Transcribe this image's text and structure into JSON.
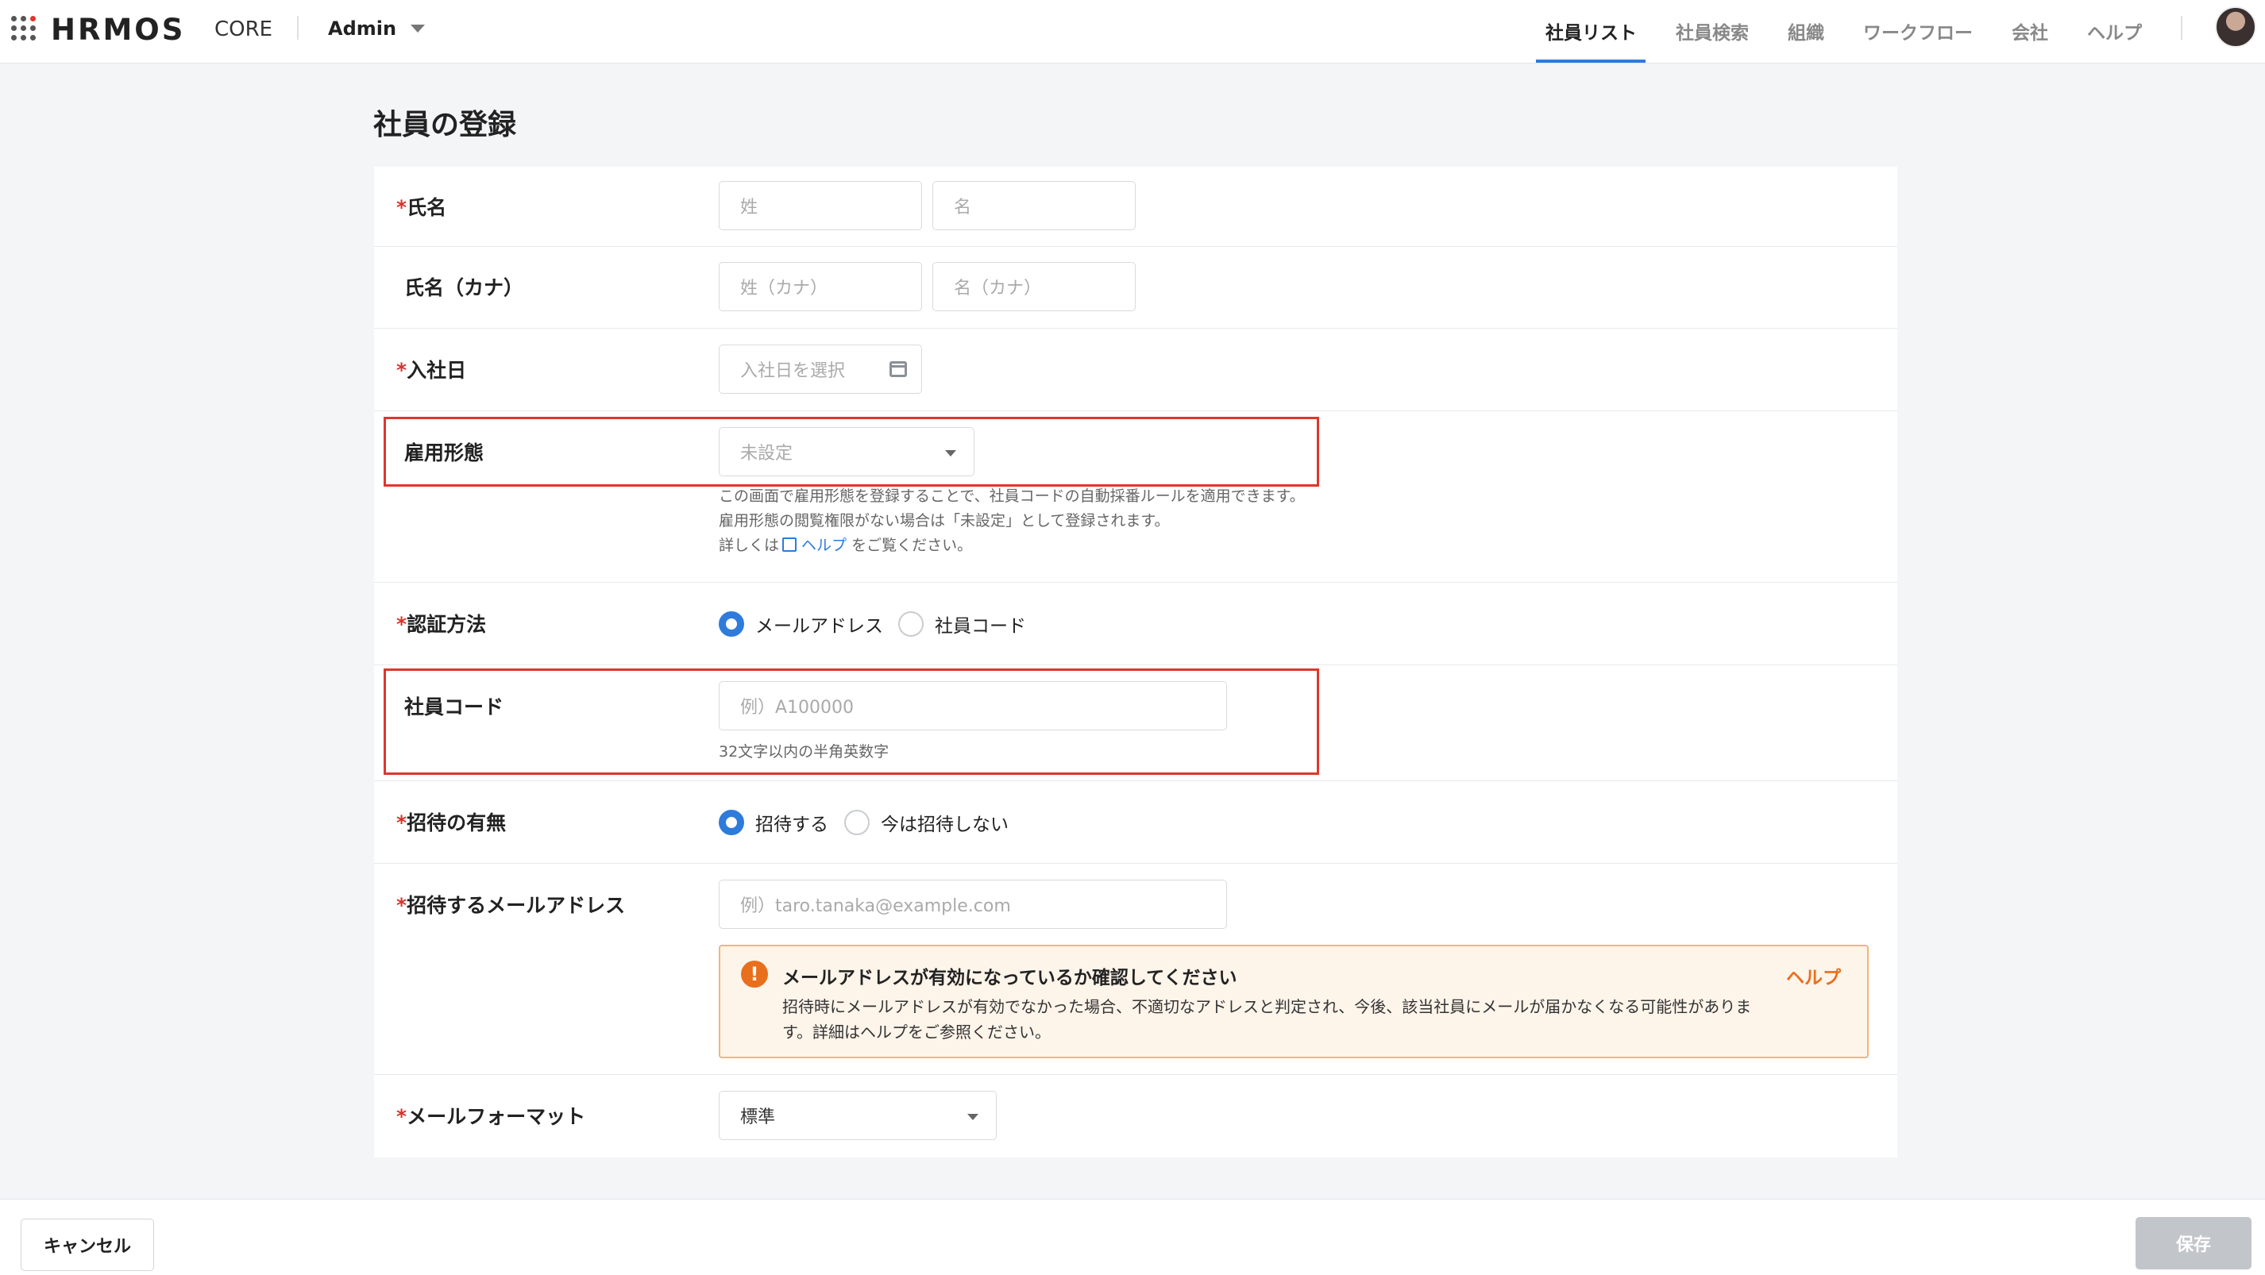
{
  "header": {
    "logo": "HRMOS",
    "product": "CORE",
    "workspace": "Admin",
    "nav": [
      {
        "label": "社員リスト",
        "active": true
      },
      {
        "label": "社員検索",
        "active": false
      },
      {
        "label": "組織",
        "active": false
      },
      {
        "label": "ワークフロー",
        "active": false
      },
      {
        "label": "会社",
        "active": false
      },
      {
        "label": "ヘルプ",
        "active": false
      }
    ],
    "accent_color": "#2e7bdc"
  },
  "page": {
    "title": "社員の登録"
  },
  "form": {
    "required_mark": "*",
    "name": {
      "label": "氏名",
      "last_placeholder": "姓",
      "first_placeholder": "名"
    },
    "kana": {
      "label": "氏名（カナ）",
      "last_placeholder": "姓（カナ）",
      "first_placeholder": "名（カナ）"
    },
    "join_date": {
      "label": "入社日",
      "placeholder": "入社日を選択"
    },
    "employment_type": {
      "label": "雇用形態",
      "value": "未設定",
      "hint_1": "この画面で雇用形態を登録することで、社員コードの自動採番ルールを適用できます。",
      "hint_2": "雇用形態の閲覧権限がない場合は「未設定」として登録されます。",
      "hint_3_prefix": "詳しくは",
      "hint_3_link": "ヘルプ",
      "hint_3_suffix": "をご覧ください。"
    },
    "auth_method": {
      "label": "認証方法",
      "options": [
        {
          "label": "メールアドレス",
          "selected": true
        },
        {
          "label": "社員コード",
          "selected": false
        }
      ]
    },
    "employee_code": {
      "label": "社員コード",
      "placeholder": "例）A100000",
      "hint": "32文字以内の半角英数字"
    },
    "invite": {
      "label": "招待の有無",
      "options": [
        {
          "label": "招待する",
          "selected": true
        },
        {
          "label": "今は招待しない",
          "selected": false
        }
      ]
    },
    "invite_email": {
      "label": "招待するメールアドレス",
      "placeholder": "例）taro.tanaka@example.com",
      "alert_title": "メールアドレスが有効になっているか確認してください",
      "alert_body": "招待時にメールアドレスが有効でなかった場合、不適切なアドレスと判定され、今後、該当社員にメールが届かなくなる可能性があります。詳細はヘルプをご参照ください。",
      "alert_help": "ヘルプ",
      "alert_icon": "!"
    },
    "mail_format": {
      "label": "メールフォーマット",
      "value": "標準"
    }
  },
  "footer": {
    "cancel": "キャンセル",
    "save": "保存"
  }
}
